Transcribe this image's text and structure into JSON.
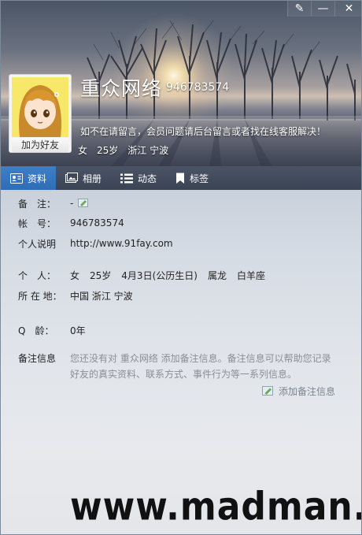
{
  "window_controls": {
    "skin": "✎",
    "minimize": "—",
    "close": "✕"
  },
  "profile": {
    "nickname": "重众网络",
    "qq_number": "946783574",
    "signature": "如不在请留言，会员问题请后台留言或者找在线客服解决！",
    "brief": {
      "gender": "女",
      "age": "25岁",
      "location": "浙江 宁波"
    },
    "add_friend_label": "加为好友"
  },
  "tabs": [
    {
      "label": "资料",
      "icon": "profile-card-icon"
    },
    {
      "label": "相册",
      "icon": "photo-album-icon"
    },
    {
      "label": "动态",
      "icon": "feed-list-icon"
    },
    {
      "label": "标签",
      "icon": "bookmark-tag-icon"
    }
  ],
  "details": {
    "remark": {
      "label": "备　注：",
      "value": "-"
    },
    "account": {
      "label": "帐　号：",
      "value": "946783574"
    },
    "homepage": {
      "label": "个人说明",
      "value": "http://www.91fay.com"
    },
    "personal": {
      "label": "个　人：",
      "gender": "女",
      "age": "25岁",
      "birthday": "4月3日(公历生日)",
      "zodiac": "属龙",
      "constellation": "白羊座"
    },
    "location": {
      "label": "所 在 地：",
      "value": "中国 浙江 宁波"
    },
    "qq_age": {
      "label": "Q　龄：",
      "value": "0年"
    },
    "remark_info": {
      "label": "备注信息",
      "text": "您还没有对 重众网络 添加备注信息。备注信息可以帮助您记录好友的真实资料、联系方式、事件行为等一系列信息。",
      "add_label": "添加备注信息"
    }
  },
  "watermark": "www.madman.in"
}
